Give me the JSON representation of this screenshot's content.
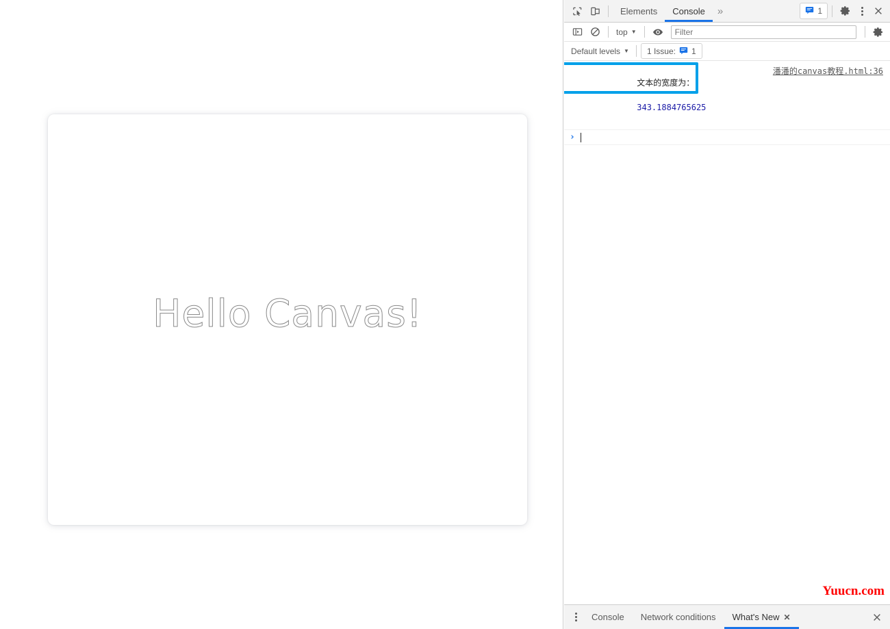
{
  "page": {
    "canvas": {
      "text": "Hello Canvas!",
      "text_style": "stroke",
      "stroke_color": "#8a8a8a"
    }
  },
  "devtools": {
    "tabbar": {
      "inspect_icon": "inspect-element-icon",
      "device_icon": "device-toolbar-icon",
      "tabs": [
        {
          "label": "Elements",
          "active": false
        },
        {
          "label": "Console",
          "active": true
        }
      ],
      "more_tabs": "»",
      "issues_badge": {
        "icon": "message-icon",
        "count": "1"
      },
      "settings_icon": "gear-icon",
      "menu_icon": "kebab-menu-icon",
      "close_icon": "close-icon"
    },
    "toolbar": {
      "sidebar_icon": "console-sidebar-icon",
      "clear_icon": "clear-console-icon",
      "context": "top",
      "eye_icon": "live-expression-eye-icon",
      "filter_placeholder": "Filter",
      "filter_value": "",
      "settings_icon": "console-settings-gear-icon"
    },
    "levels": {
      "levels_label": "Default levels",
      "issue_chip_label": "1 Issue:",
      "issue_chip_icon": "message-icon",
      "issue_chip_count": "1"
    },
    "console": {
      "message": {
        "label": "文本的宽度为：",
        "value": "343.1884765625",
        "source": "潘潘的canvas教程.html:36"
      },
      "prompt_chevron": "›",
      "highlight_color": "#00a0e9"
    },
    "watermark": "Yuucn.com",
    "drawer": {
      "menu_icon": "drawer-kebab-icon",
      "tabs": [
        {
          "label": "Console",
          "active": false,
          "closable": false
        },
        {
          "label": "Network conditions",
          "active": false,
          "closable": false
        },
        {
          "label": "What's New",
          "active": true,
          "closable": true
        }
      ],
      "close_label": "✕",
      "close_icon": "drawer-close-icon"
    }
  },
  "colors": {
    "accent": "#1a73e8",
    "highlight": "#00a0e9",
    "number": "#1a1aa6",
    "watermark": "#ff0000"
  }
}
